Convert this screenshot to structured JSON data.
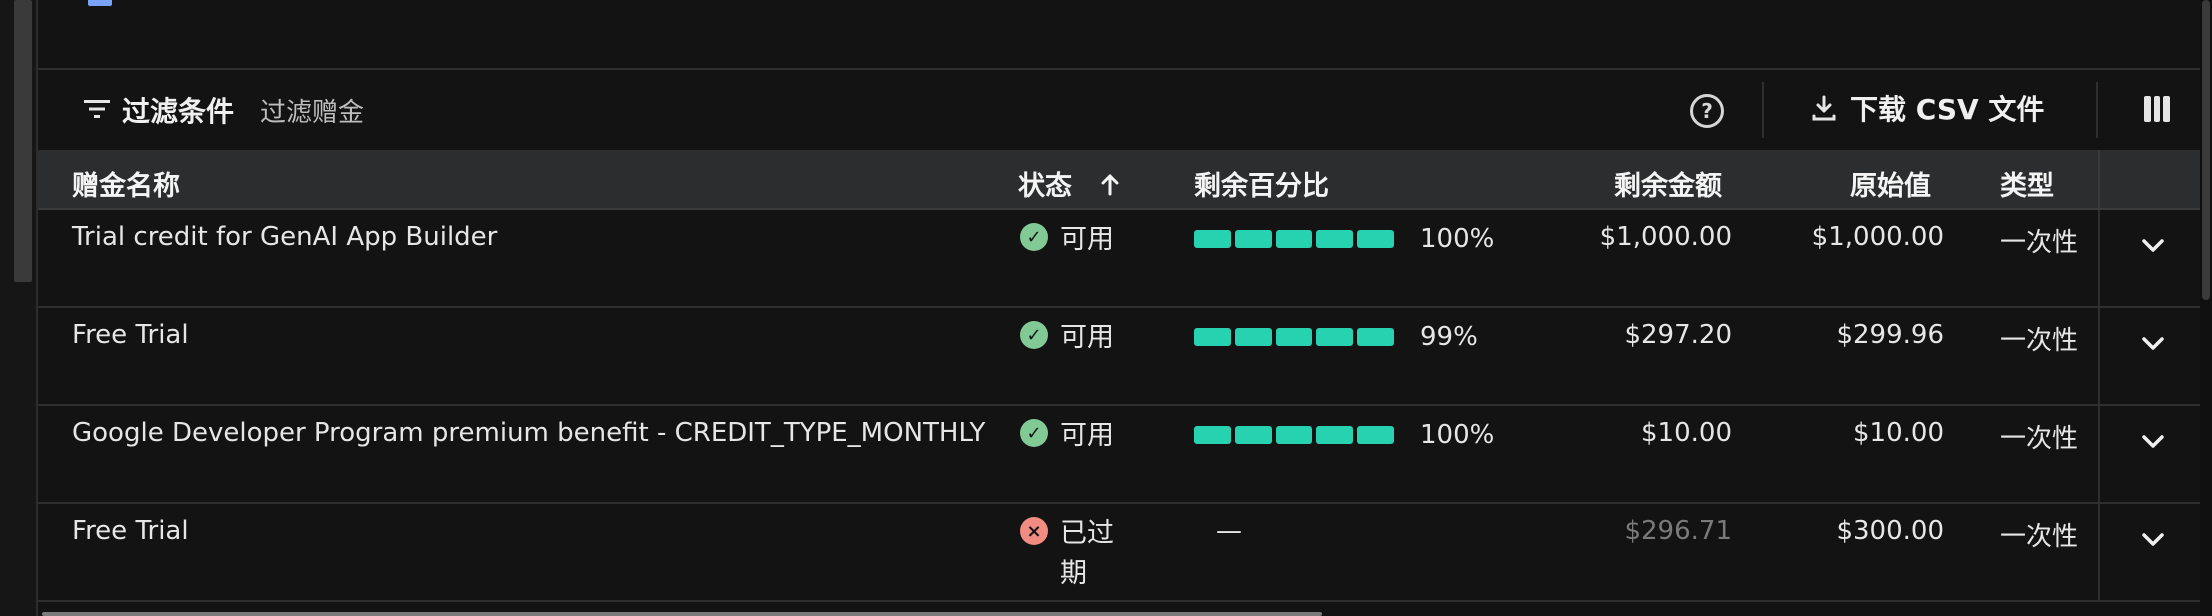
{
  "toolbar": {
    "filter_title": "过滤条件",
    "filter_placeholder": "过滤赠金",
    "download_label": "下载 CSV 文件"
  },
  "icons": {
    "filter": "filter-list-icon",
    "help": "help-circle-icon",
    "download": "download-icon",
    "columns": "column-view-icon",
    "sort": "arrow-up-icon",
    "expand": "chevron-down-icon",
    "ok": "check-circle-icon",
    "expired": "x-circle-icon"
  },
  "colors": {
    "bar": "#26d2b0",
    "ok": "#81c995",
    "expired": "#f28b82",
    "header_bg": "#2b2d2e",
    "bg": "#121212"
  },
  "table": {
    "headers": {
      "name": "赠金名称",
      "status": "状态",
      "pct": "剩余百分比",
      "remain": "剩余金额",
      "orig": "原始值",
      "type": "类型"
    },
    "rows": [
      {
        "name": "Trial credit for GenAI App Builder",
        "status": "可用",
        "status_kind": "ok",
        "pct": "100%",
        "remain": "$1,000.00",
        "orig": "$1,000.00",
        "type": "一次性"
      },
      {
        "name": "Free Trial",
        "status": "可用",
        "status_kind": "ok",
        "pct": "99%",
        "remain": "$297.20",
        "orig": "$299.96",
        "type": "一次性"
      },
      {
        "name": "Google Developer Program premium benefit - CREDIT_TYPE_MONTHLY",
        "status": "可用",
        "status_kind": "ok",
        "pct": "100%",
        "remain": "$10.00",
        "orig": "$10.00",
        "type": "一次性"
      },
      {
        "name": "Free Trial",
        "status": "已过期",
        "status_kind": "expired",
        "pct_dash": "—",
        "remain": "$296.71",
        "orig": "$300.00",
        "type": "一次性"
      }
    ]
  }
}
